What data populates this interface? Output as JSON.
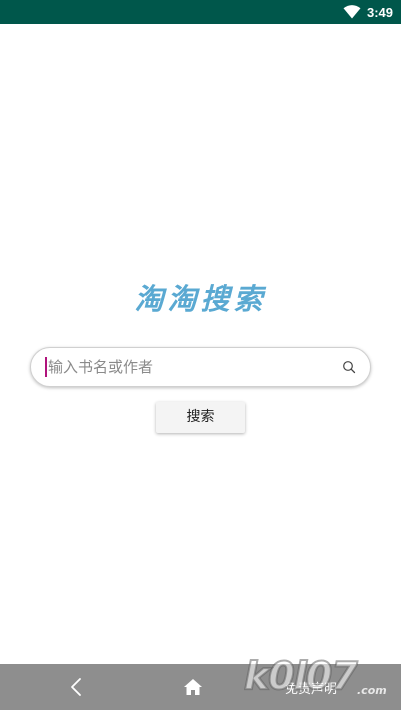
{
  "status_bar": {
    "time": "3:49",
    "icons": [
      "wifi-icon"
    ],
    "bg_color": "#00574b"
  },
  "logo": {
    "title": "淘淘搜索",
    "color": "#5aa9d2"
  },
  "search": {
    "placeholder": "输入书名或作者",
    "value": "",
    "icon": "search-icon",
    "cursor_color": "#b0137c"
  },
  "search_button": {
    "label": "搜索"
  },
  "bottom_bar": {
    "icons": [
      "back-icon",
      "home-icon"
    ],
    "disclaimer_label": "免责声明",
    "bg_color": "#8e8e8e"
  },
  "watermark": {
    "text": "k0l07",
    "suffix": ".com"
  }
}
